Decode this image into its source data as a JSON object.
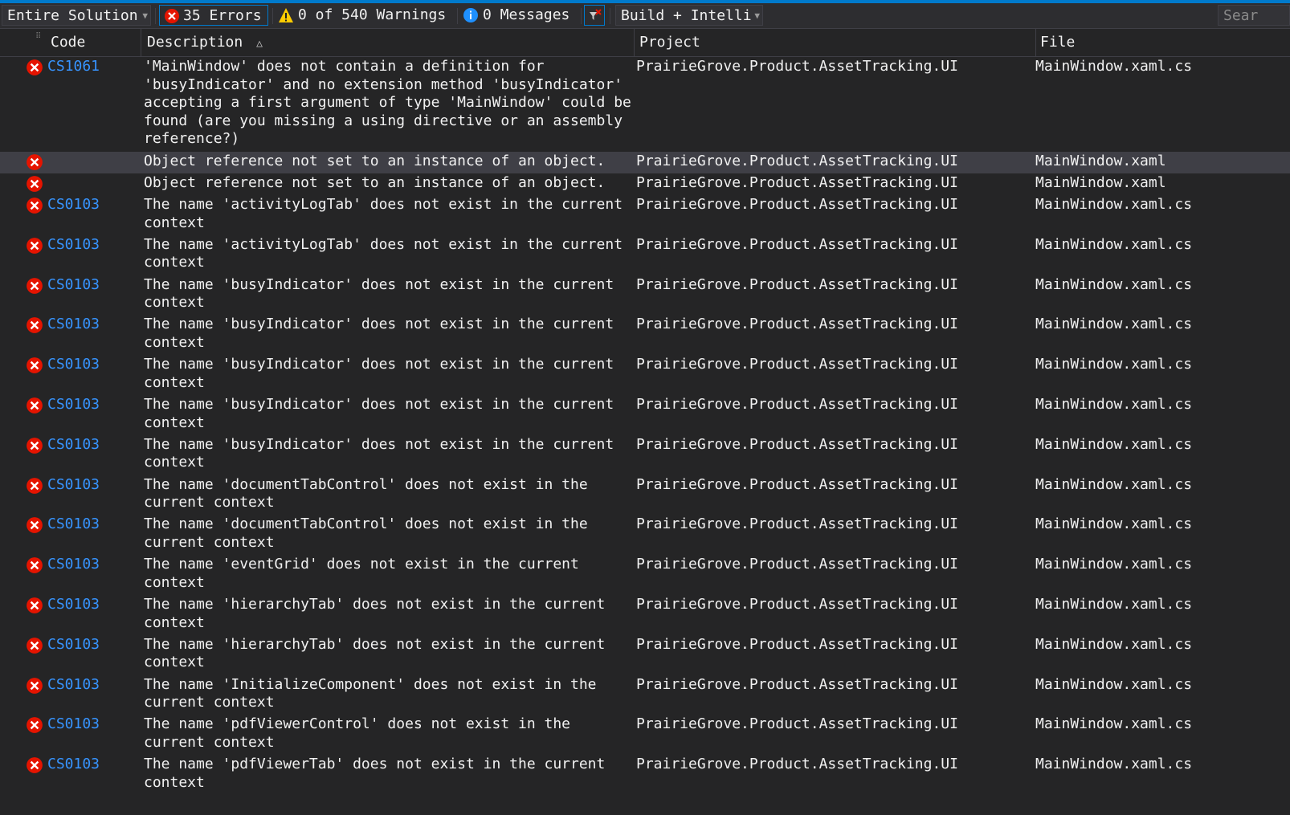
{
  "toolbar": {
    "scope": "Entire Solution",
    "errors": "35 Errors",
    "warnings": "0 of 540 Warnings",
    "messages": "0 Messages",
    "build": "Build + Intelli",
    "search": "Sear"
  },
  "columns": {
    "code": "Code",
    "description": "Description",
    "project": "Project",
    "file": "File"
  },
  "colors": {
    "error": "#e51400",
    "link": "#3794ff",
    "accent": "#007acc",
    "warning": "#ffcc00",
    "info": "#1e90ff"
  },
  "rows": [
    {
      "code": "CS1061",
      "desc": "'MainWindow' does not contain a definition for\n'busyIndicator' and no extension method 'busyIndicator'\naccepting a first argument of type 'MainWindow' could be\nfound (are you missing a using directive or an assembly\nreference?)",
      "project": "PrairieGrove.Product.AssetTracking.UI",
      "file": "MainWindow.xaml.cs",
      "selected": false
    },
    {
      "code": "",
      "desc": "Object reference not set to an instance of an object.",
      "project": "PrairieGrove.Product.AssetTracking.UI",
      "file": "MainWindow.xaml",
      "selected": true
    },
    {
      "code": "",
      "desc": "Object reference not set to an instance of an object.",
      "project": "PrairieGrove.Product.AssetTracking.UI",
      "file": "MainWindow.xaml",
      "selected": false
    },
    {
      "code": "CS0103",
      "desc": "The name 'activityLogTab' does not exist in the current\ncontext",
      "project": "PrairieGrove.Product.AssetTracking.UI",
      "file": "MainWindow.xaml.cs",
      "selected": false
    },
    {
      "code": "CS0103",
      "desc": "The name 'activityLogTab' does not exist in the current\ncontext",
      "project": "PrairieGrove.Product.AssetTracking.UI",
      "file": "MainWindow.xaml.cs",
      "selected": false
    },
    {
      "code": "CS0103",
      "desc": "The name 'busyIndicator' does not exist in the current\ncontext",
      "project": "PrairieGrove.Product.AssetTracking.UI",
      "file": "MainWindow.xaml.cs",
      "selected": false
    },
    {
      "code": "CS0103",
      "desc": "The name 'busyIndicator' does not exist in the current\ncontext",
      "project": "PrairieGrove.Product.AssetTracking.UI",
      "file": "MainWindow.xaml.cs",
      "selected": false
    },
    {
      "code": "CS0103",
      "desc": "The name 'busyIndicator' does not exist in the current\ncontext",
      "project": "PrairieGrove.Product.AssetTracking.UI",
      "file": "MainWindow.xaml.cs",
      "selected": false
    },
    {
      "code": "CS0103",
      "desc": "The name 'busyIndicator' does not exist in the current\ncontext",
      "project": "PrairieGrove.Product.AssetTracking.UI",
      "file": "MainWindow.xaml.cs",
      "selected": false
    },
    {
      "code": "CS0103",
      "desc": "The name 'busyIndicator' does not exist in the current\ncontext",
      "project": "PrairieGrove.Product.AssetTracking.UI",
      "file": "MainWindow.xaml.cs",
      "selected": false
    },
    {
      "code": "CS0103",
      "desc": "The name 'documentTabControl' does not exist in the\ncurrent context",
      "project": "PrairieGrove.Product.AssetTracking.UI",
      "file": "MainWindow.xaml.cs",
      "selected": false
    },
    {
      "code": "CS0103",
      "desc": "The name 'documentTabControl' does not exist in the\ncurrent context",
      "project": "PrairieGrove.Product.AssetTracking.UI",
      "file": "MainWindow.xaml.cs",
      "selected": false
    },
    {
      "code": "CS0103",
      "desc": "The name 'eventGrid' does not exist in the current\ncontext",
      "project": "PrairieGrove.Product.AssetTracking.UI",
      "file": "MainWindow.xaml.cs",
      "selected": false
    },
    {
      "code": "CS0103",
      "desc": "The name 'hierarchyTab' does not exist in the current\ncontext",
      "project": "PrairieGrove.Product.AssetTracking.UI",
      "file": "MainWindow.xaml.cs",
      "selected": false
    },
    {
      "code": "CS0103",
      "desc": "The name 'hierarchyTab' does not exist in the current\ncontext",
      "project": "PrairieGrove.Product.AssetTracking.UI",
      "file": "MainWindow.xaml.cs",
      "selected": false
    },
    {
      "code": "CS0103",
      "desc": "The name 'InitializeComponent' does not exist in the\ncurrent context",
      "project": "PrairieGrove.Product.AssetTracking.UI",
      "file": "MainWindow.xaml.cs",
      "selected": false
    },
    {
      "code": "CS0103",
      "desc": "The name 'pdfViewerControl' does not exist in the\ncurrent context",
      "project": "PrairieGrove.Product.AssetTracking.UI",
      "file": "MainWindow.xaml.cs",
      "selected": false
    },
    {
      "code": "CS0103",
      "desc": "The name 'pdfViewerTab' does not exist in the current\ncontext",
      "project": "PrairieGrove.Product.AssetTracking.UI",
      "file": "MainWindow.xaml.cs",
      "selected": false
    }
  ]
}
